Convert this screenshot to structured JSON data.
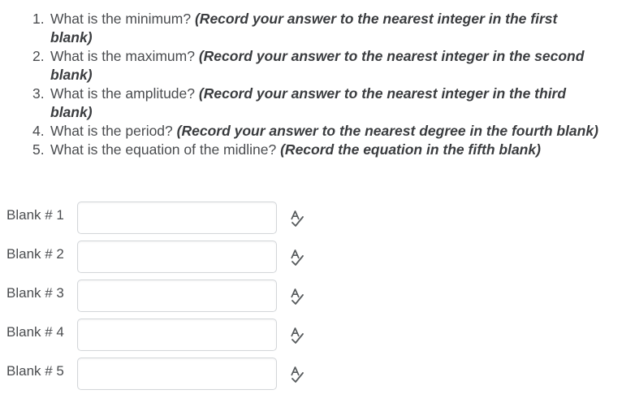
{
  "questions": [
    {
      "num": "1.",
      "text": "What is the minimum?",
      "instruction": "(Record your answer to the nearest integer in the first blank)"
    },
    {
      "num": "2.",
      "text": "What is the maximum?",
      "instruction": "(Record your answer to the nearest integer in the second blank)"
    },
    {
      "num": "3.",
      "text": "What is the amplitude?",
      "instruction": "(Record your answer to the nearest integer in the third blank)"
    },
    {
      "num": "4.",
      "text": "What is the period?",
      "instruction": "(Record your answer to the nearest degree in the fourth blank)"
    },
    {
      "num": "5.",
      "text": "What is the equation of the midline?",
      "instruction": "(Record the equation in the fifth blank)"
    }
  ],
  "blanks": [
    {
      "label": "Blank # 1",
      "value": "",
      "icon": "spell-check-icon"
    },
    {
      "label": "Blank # 2",
      "value": "",
      "icon": "spell-check-icon"
    },
    {
      "label": "Blank # 3",
      "value": "",
      "icon": "spell-check-icon"
    },
    {
      "label": "Blank # 4",
      "value": "",
      "icon": "spell-check-icon"
    },
    {
      "label": "Blank # 5",
      "value": "",
      "icon": "spell-check-icon"
    }
  ],
  "colors": {
    "text": "#4a4c4f",
    "input_border": "#d3d6d9",
    "icon": "#565a5c"
  }
}
